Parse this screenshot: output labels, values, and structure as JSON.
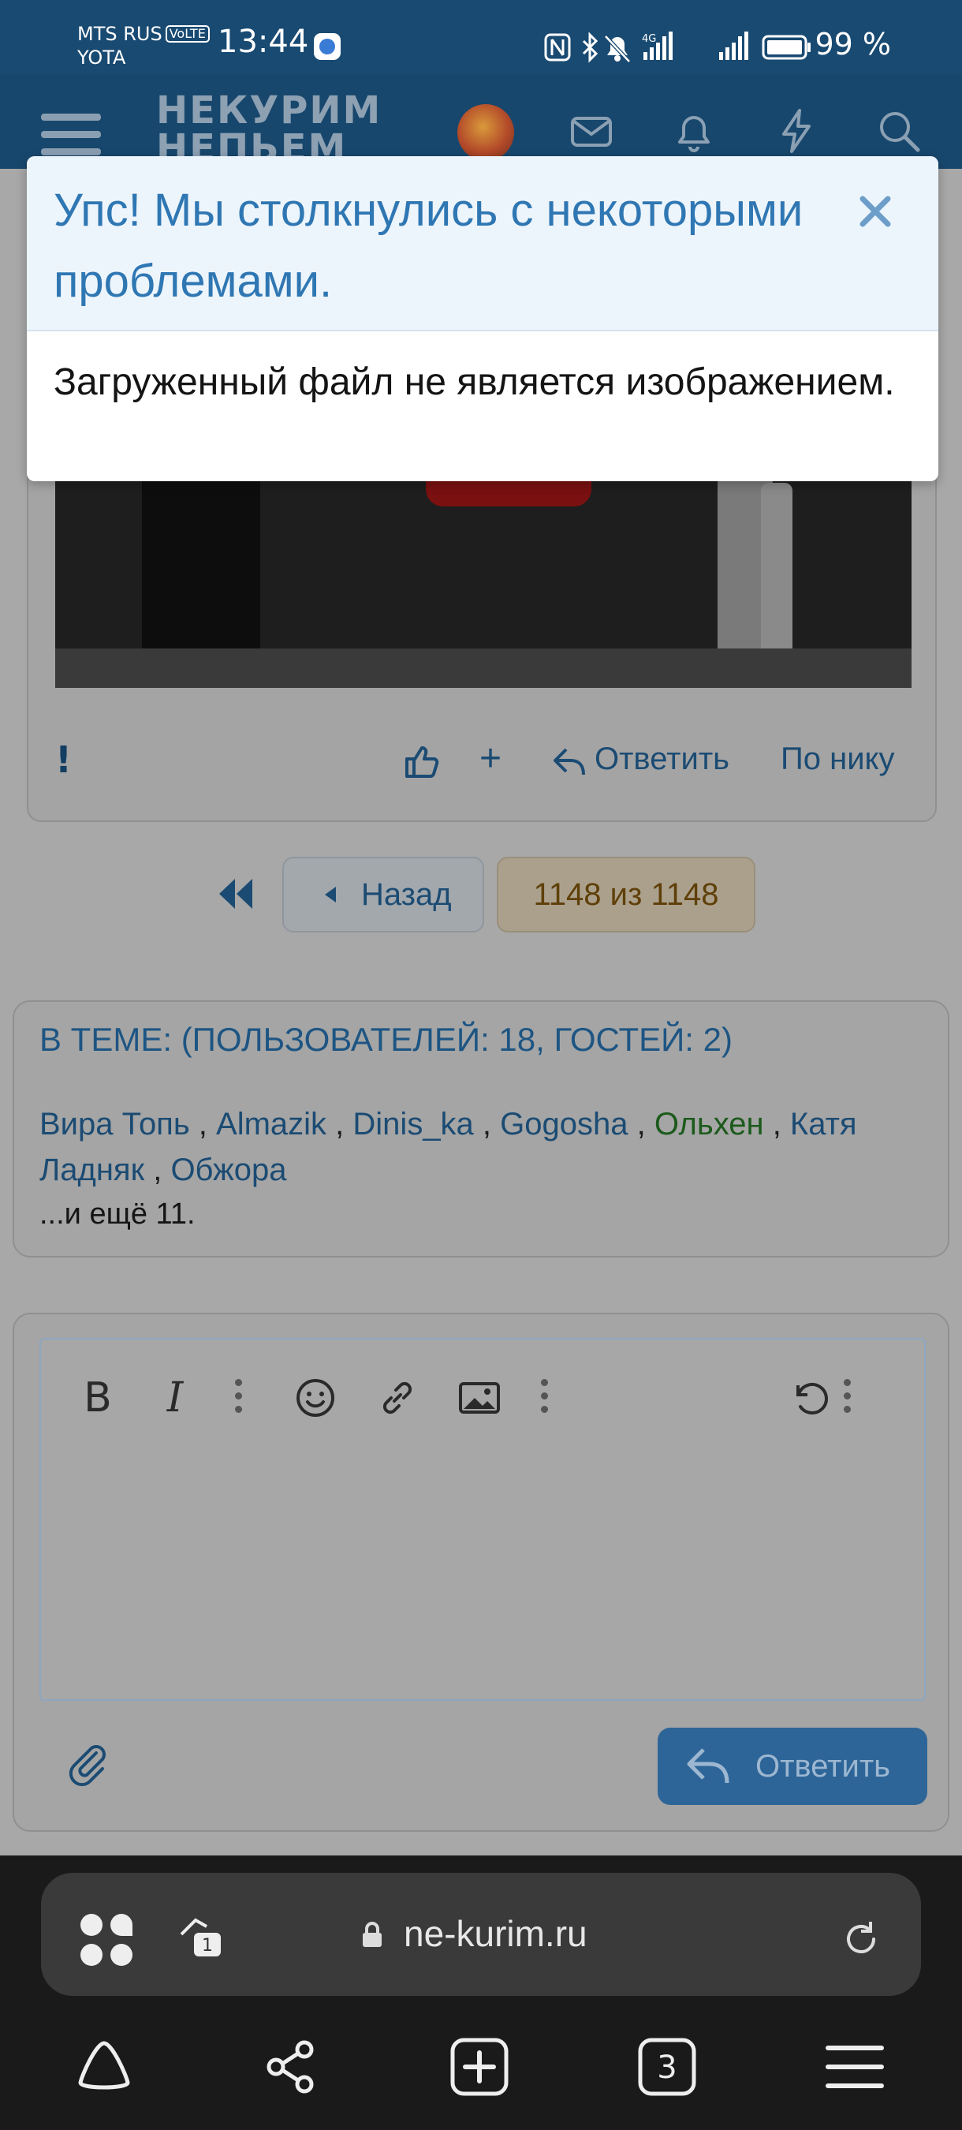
{
  "status_bar": {
    "carrier_primary": "MTS RUS",
    "volte_badge": "VoLTE",
    "carrier_secondary": "YOTA",
    "time": "13:44",
    "network_badge": "4G",
    "battery": "99 %"
  },
  "site_header": {
    "logo_line1": "НЕКУРИМ",
    "logo_line2": "НЕПЬЕМ",
    "icons": [
      "menu-icon",
      "mail-icon",
      "bell-icon",
      "lightning-icon",
      "search-icon"
    ]
  },
  "error_dialog": {
    "title": "Упс! Мы столкнулись с некоторыми проблемами.",
    "message": "Загруженный файл не является изображением."
  },
  "post_actions": {
    "report": "!",
    "plus": "+",
    "reply": "Ответить",
    "by_nick": "По нику"
  },
  "pagination": {
    "back": "Назад",
    "current": "1148 из 1148"
  },
  "online": {
    "title": "В ТЕМЕ: (ПОЛЬЗОВАТЕЛЕЙ: 18, ГОСТЕЙ: 2)",
    "users": [
      "Вира Топь",
      "Almazik",
      "Dinis_ka",
      "Gogosha",
      "Ольхен",
      "Катя Ладняк",
      "Обжора"
    ],
    "more": "...и ещё 11."
  },
  "editor": {
    "toolbar": [
      "bold-icon",
      "italic-icon",
      "more-icon",
      "emoji-icon",
      "link-icon",
      "image-icon",
      "more-icon",
      "undo-icon",
      "more-icon"
    ],
    "reply_button": "Ответить"
  },
  "browser": {
    "url": "ne-kurim.ru",
    "tab_count": "1",
    "open_tabs": "3"
  },
  "colors": {
    "accent_blue": "#2f77b3",
    "header_bg": "#194a72",
    "online_green_user": "#1c5a1c"
  }
}
